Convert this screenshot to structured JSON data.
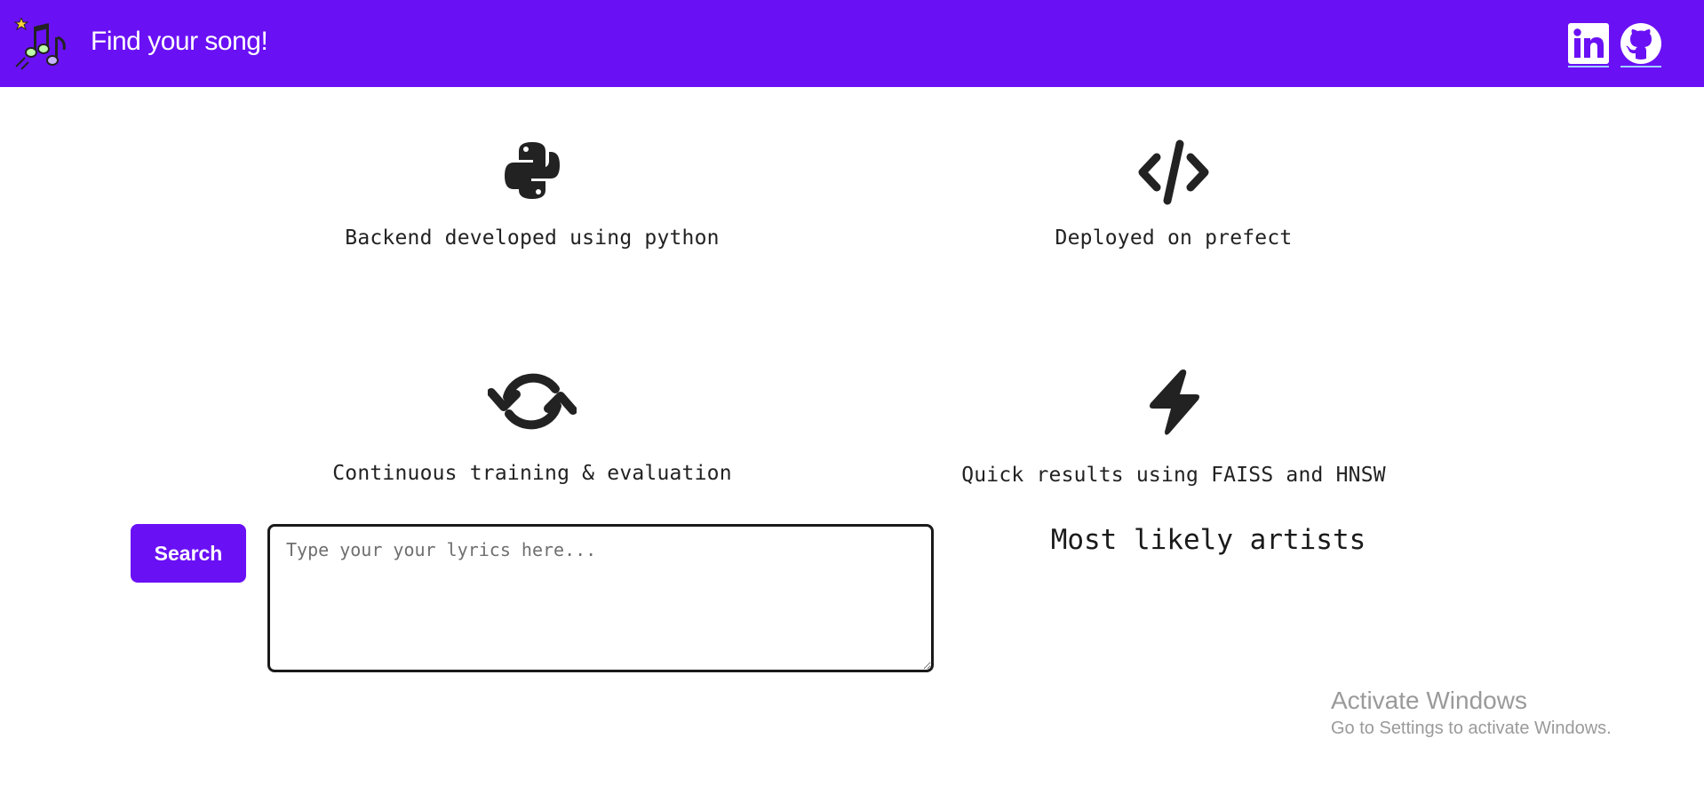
{
  "header": {
    "title": "Find your song!",
    "logo_icon": "music-notes-icon",
    "background_color": "#6a10f5",
    "links": [
      {
        "name": "linkedin",
        "icon": "linkedin-icon"
      },
      {
        "name": "github",
        "icon": "github-icon"
      }
    ]
  },
  "features": [
    {
      "icon": "python-icon",
      "label": "Backend developed using python"
    },
    {
      "icon": "code-icon",
      "label": "Deployed on prefect"
    },
    {
      "icon": "sync-icon",
      "label": "Continuous training & evaluation"
    },
    {
      "icon": "bolt-icon",
      "label": "Quick results using FAISS and HNSW"
    }
  ],
  "search": {
    "button_label": "Search",
    "placeholder": "Type your your lyrics here...",
    "value": ""
  },
  "results": {
    "title": "Most likely artists"
  },
  "watermark": {
    "line1": "Activate Windows",
    "line2": "Go to Settings to activate Windows."
  },
  "colors": {
    "accent": "#6a10f5",
    "text": "#222222",
    "icon": "#222222"
  }
}
